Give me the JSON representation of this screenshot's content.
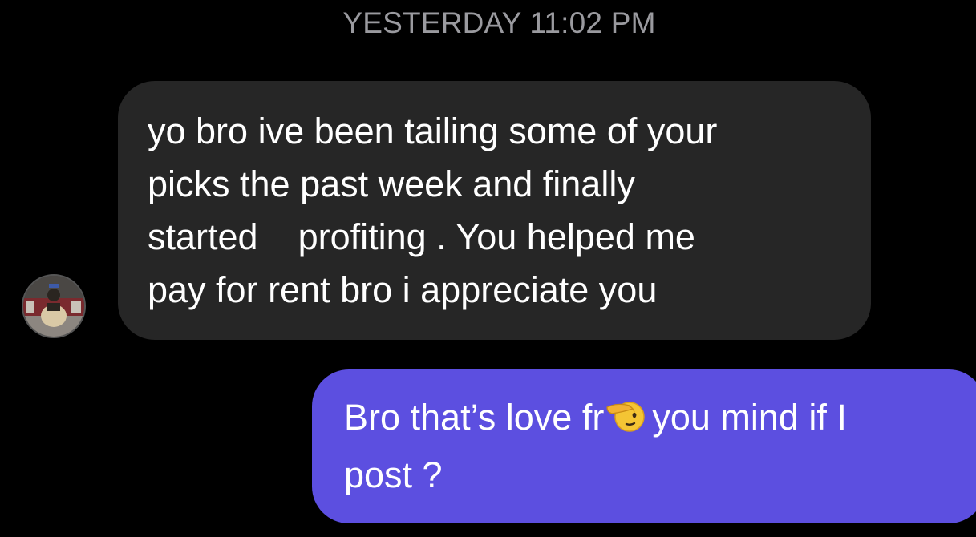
{
  "thread": {
    "timestamp": "YESTERDAY 11:02 PM"
  },
  "messages": [
    {
      "sender": "other",
      "lines": [
        "yo bro ive been tailing some of your",
        "picks the past week and finally",
        "started    profiting . You helped me",
        "pay for rent bro i appreciate you"
      ]
    },
    {
      "sender": "me",
      "line1_before_emoji": "Bro that’s love fr",
      "emoji": "saluting-face",
      "line1_after_emoji": "you mind if I",
      "line2": "post ?"
    }
  ],
  "colors": {
    "background": "#000000",
    "incoming_bubble": "#262626",
    "outgoing_bubble": "#5c4fe0",
    "timestamp_text": "#9a9a9f",
    "message_text": "#ffffff"
  }
}
